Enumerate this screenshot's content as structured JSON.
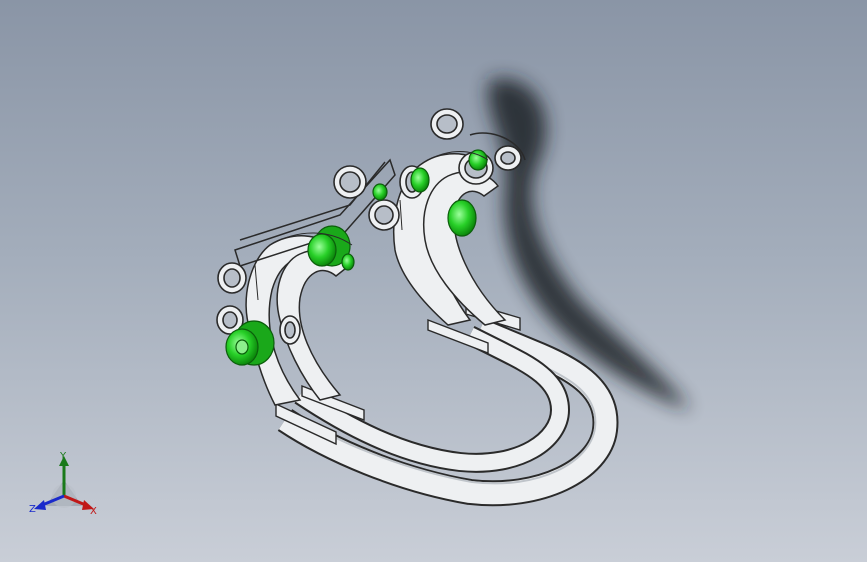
{
  "viewport": {
    "background_top": "#8a95a6",
    "background_bottom": "#c9ced7"
  },
  "model": {
    "part_color": "#eef0f2",
    "edge_color": "#2a2a2a",
    "highlight_color": "#33d433",
    "shadow_color": "#1e2226"
  },
  "triad": {
    "x_label": "X",
    "y_label": "Y",
    "z_label": "Z",
    "x_color": "#c01818",
    "y_color": "#1a7a1a",
    "z_color": "#1a2acb"
  }
}
